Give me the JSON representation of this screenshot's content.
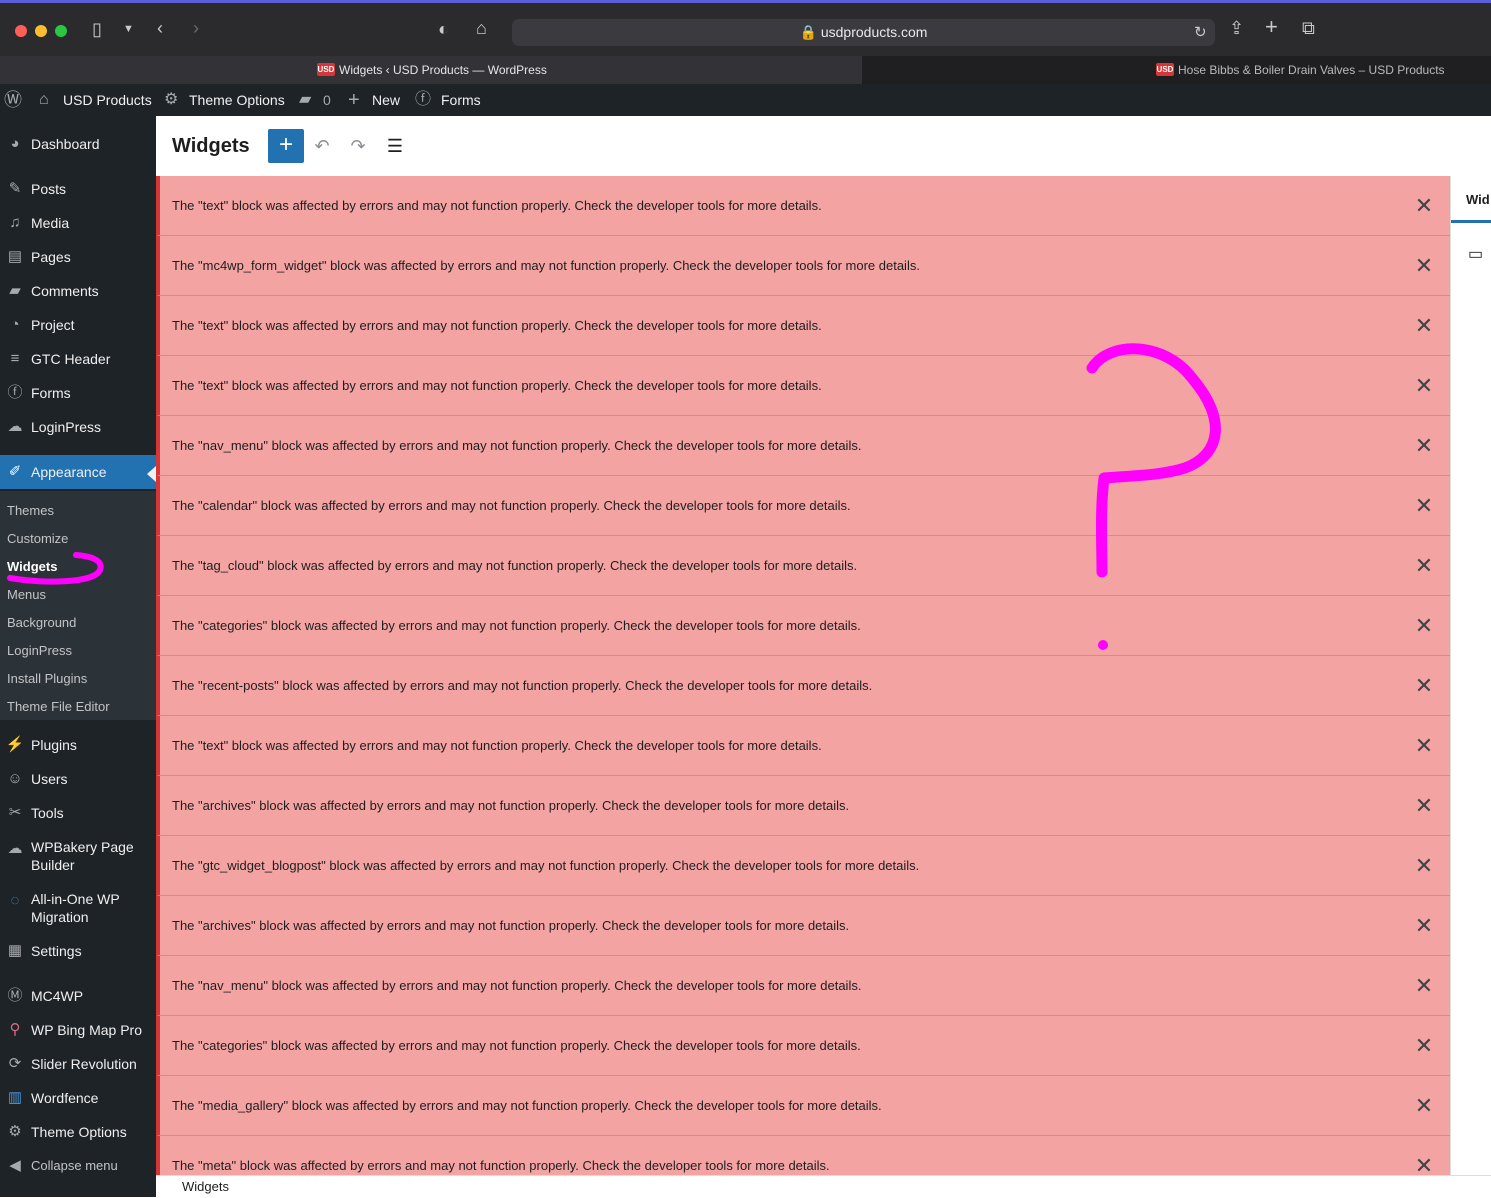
{
  "browser": {
    "url": "usdproducts.com",
    "tabs": [
      {
        "favicon": "USD",
        "title": "Widgets ‹ USD Products — WordPress",
        "active": true
      },
      {
        "favicon": "USD",
        "title": "Hose Bibbs & Boiler Drain Valves – USD Products",
        "active": false
      }
    ],
    "icons": {
      "sidebar": "sidebar-icon",
      "back": "back-icon",
      "forward": "forward-icon",
      "shield": "shield-icon",
      "home": "home-icon",
      "reload": "reload-icon",
      "share": "share-icon",
      "new_tab": "plus-icon",
      "tabs_overview": "tabs-icon"
    }
  },
  "adminbar": {
    "site_name": "USD Products",
    "theme_options": "Theme Options",
    "comments_count": "0",
    "new_label": "New",
    "forms_label": "Forms"
  },
  "sidebar": {
    "top_item": "Dashboard",
    "items_a": [
      "Posts",
      "Media",
      "Pages",
      "Comments",
      "Project",
      "GTC Header",
      "Forms",
      "LoginPress"
    ],
    "appearance": "Appearance",
    "submenu": [
      "Themes",
      "Customize",
      "Widgets",
      "Menus",
      "Background",
      "LoginPress",
      "Install Plugins",
      "Theme File Editor"
    ],
    "submenu_current": "Widgets",
    "items_b": [
      "Plugins",
      "Users",
      "Tools"
    ],
    "wpbakery": [
      "WPBakery Page",
      "Builder"
    ],
    "aio": [
      "All-in-One WP",
      "Migration"
    ],
    "settings": "Settings",
    "items_c": [
      "MC4WP",
      "WP Bing Map Pro",
      "Slider Revolution",
      "Wordfence",
      "Theme Options"
    ],
    "collapse": "Collapse menu"
  },
  "header": {
    "title": "Widgets",
    "add_label": "+"
  },
  "notices": [
    "The \"text\" block was affected by errors and may not function properly. Check the developer tools for more details.",
    "The \"mc4wp_form_widget\" block was affected by errors and may not function properly. Check the developer tools for more details.",
    "The \"text\" block was affected by errors and may not function properly. Check the developer tools for more details.",
    "The \"text\" block was affected by errors and may not function properly. Check the developer tools for more details.",
    "The \"nav_menu\" block was affected by errors and may not function properly. Check the developer tools for more details.",
    "The \"calendar\" block was affected by errors and may not function properly. Check the developer tools for more details.",
    "The \"tag_cloud\" block was affected by errors and may not function properly. Check the developer tools for more details.",
    "The \"categories\" block was affected by errors and may not function properly. Check the developer tools for more details.",
    "The \"recent-posts\" block was affected by errors and may not function properly. Check the developer tools for more details.",
    "The \"text\" block was affected by errors and may not function properly. Check the developer tools for more details.",
    "The \"archives\" block was affected by errors and may not function properly. Check the developer tools for more details.",
    "The \"gtc_widget_blogpost\" block was affected by errors and may not function properly. Check the developer tools for more details.",
    "The \"archives\" block was affected by errors and may not function properly. Check the developer tools for more details.",
    "The \"nav_menu\" block was affected by errors and may not function properly. Check the developer tools for more details.",
    "The \"categories\" block was affected by errors and may not function properly. Check the developer tools for more details.",
    "The \"media_gallery\" block was affected by errors and may not function properly. Check the developer tools for more details.",
    "The \"meta\" block was affected by errors and may not function properly. Check the developer tools for more details."
  ],
  "right_panel": {
    "tab": "Wid"
  },
  "footer": {
    "breadcrumb": "Widgets"
  },
  "colors": {
    "notice_bg": "#f4a3a3",
    "notice_border": "#d63638",
    "accent": "#2271b1",
    "annotation": "#ff00ff"
  }
}
